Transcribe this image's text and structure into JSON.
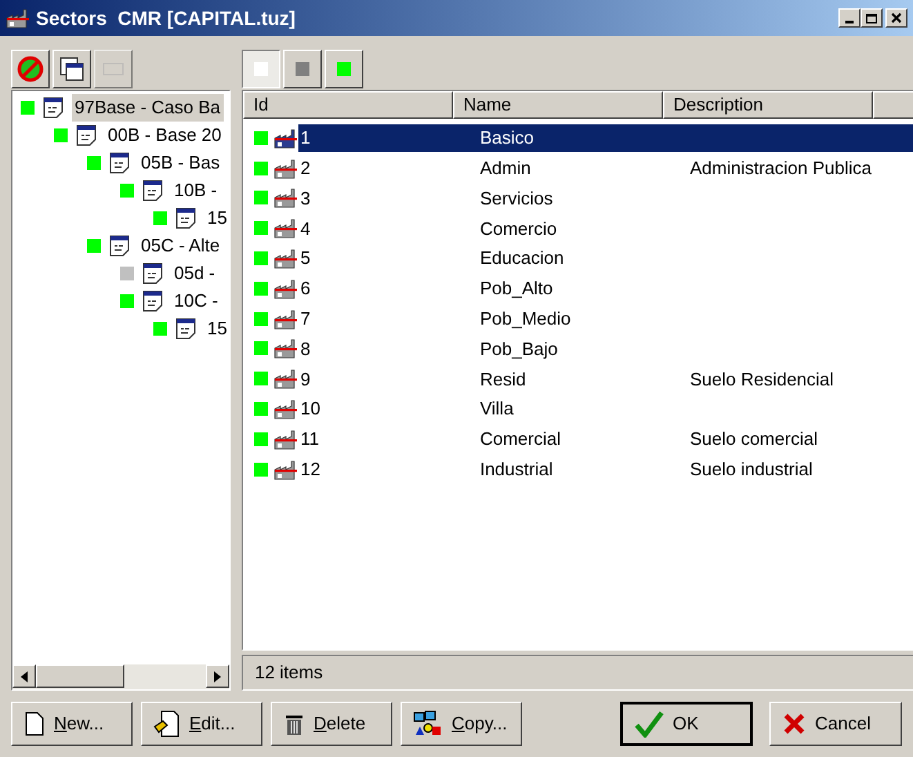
{
  "window": {
    "title": "Sectors  CMR [CAPITAL.tuz]"
  },
  "left_toolbar": [
    {
      "kind": "forbid",
      "disabled": false
    },
    {
      "kind": "doc",
      "disabled": false
    },
    {
      "kind": "faded",
      "disabled": true
    }
  ],
  "tree": [
    {
      "label": "97Base  - Caso Ba",
      "color": "#00ff00",
      "selected": true,
      "children": [
        {
          "label": "00B  - Base 20",
          "color": "#00ff00",
          "selected": false,
          "children": [
            {
              "label": "05B  - Bas",
              "color": "#00ff00",
              "selected": false,
              "children": [
                {
                  "label": "10B  -",
                  "color": "#00ff00",
                  "selected": false,
                  "children": [
                    {
                      "label": "15",
                      "color": "#00ff00",
                      "selected": false
                    }
                  ]
                }
              ]
            },
            {
              "label": "05C  - Alte",
              "color": "#00ff00",
              "selected": false,
              "children": [
                {
                  "label": "05d  -",
                  "color": "#c0c0c0",
                  "selected": false
                },
                {
                  "label": "10C  -",
                  "color": "#00ff00",
                  "selected": false,
                  "children": [
                    {
                      "label": "15",
                      "color": "#00ff00",
                      "selected": false
                    }
                  ]
                }
              ]
            }
          ]
        }
      ]
    }
  ],
  "filters": [
    {
      "color": "#ffffff",
      "selected": true
    },
    {
      "color": "#808080",
      "selected": false
    },
    {
      "color": "#00ff00",
      "selected": false
    }
  ],
  "table": {
    "columns": [
      "Id",
      "Name",
      "Description"
    ],
    "rows": [
      {
        "id": "1",
        "name": "Basico",
        "color": "#00ff00",
        "selected": true
      },
      {
        "id": "2",
        "name": "Admin",
        "description": "Administracion Publica",
        "color": "#00ff00",
        "selected": false
      },
      {
        "id": "3",
        "name": "Servicios",
        "color": "#00ff00",
        "selected": false
      },
      {
        "id": "4",
        "name": "Comercio",
        "color": "#00ff00",
        "selected": false
      },
      {
        "id": "5",
        "name": "Educacion",
        "color": "#00ff00",
        "selected": false
      },
      {
        "id": "6",
        "name": "Pob_Alto",
        "color": "#00ff00",
        "selected": false
      },
      {
        "id": "7",
        "name": "Pob_Medio",
        "color": "#00ff00",
        "selected": false
      },
      {
        "id": "8",
        "name": "Pob_Bajo",
        "color": "#00ff00",
        "selected": false
      },
      {
        "id": "9",
        "name": "Resid",
        "description": "Suelo Residencial",
        "color": "#00ff00",
        "selected": false
      },
      {
        "id": "10",
        "name": "Villa",
        "color": "#00ff00",
        "selected": false
      },
      {
        "id": "11",
        "name": "Comercial",
        "description": "Suelo comercial",
        "color": "#00ff00",
        "selected": false
      },
      {
        "id": "12",
        "name": "Industrial",
        "description": "Suelo industrial",
        "color": "#00ff00",
        "selected": false
      }
    ]
  },
  "status_bar": "12 items",
  "buttons": [
    {
      "kind": "new",
      "label": "New...",
      "mnemonic": true
    },
    {
      "kind": "edit",
      "label": "Edit...",
      "mnemonic": true
    },
    {
      "kind": "delete",
      "label": "Delete",
      "mnemonic": true
    },
    {
      "kind": "copy",
      "label": "Copy...",
      "mnemonic": true
    },
    {
      "kind": "ok",
      "label": "OK",
      "mnemonic": false
    },
    {
      "kind": "cancel",
      "label": "Cancel",
      "mnemonic": false
    }
  ]
}
